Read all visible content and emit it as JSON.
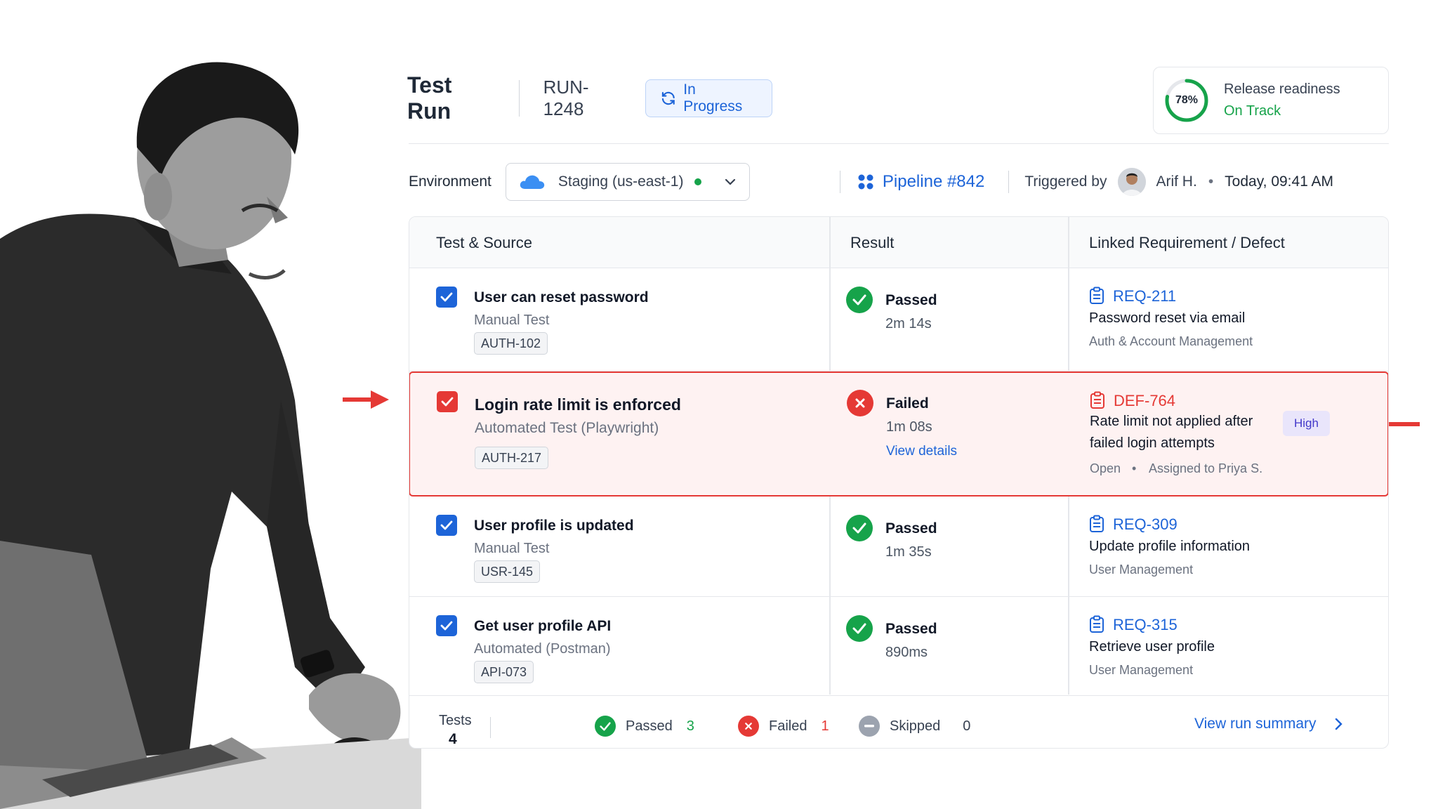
{
  "header": {
    "title": "Test Run",
    "run_id": "RUN-1248",
    "status": "In Progress"
  },
  "readiness": {
    "percent_label": "78%",
    "percent_value": 0.78,
    "label": "Release readiness",
    "status": "On Track"
  },
  "environment": {
    "label": "Environment",
    "selected": "Staging (us-east-1)",
    "health": "green"
  },
  "pipeline": {
    "label": "Pipeline #842"
  },
  "trigger": {
    "label": "Triggered by",
    "user": "Arif H.",
    "time": "Today, 09:41 AM"
  },
  "table": {
    "columns": [
      "Test & Source",
      "Result",
      "Linked Requirement / Defect"
    ],
    "rows": [
      {
        "name": "User can reset password",
        "type": "Manual Test",
        "test_id": "AUTH-102",
        "result": "Passed",
        "duration": "2m 14s",
        "link_id": "REQ-211",
        "link_title": "Password reset via email",
        "link_sub": "Auth & Account Management"
      },
      {
        "name": "Login rate limit is enforced",
        "type": "Automated Test (Playwright)",
        "test_id": "AUTH-217",
        "result": "Failed",
        "duration": "1m 08s",
        "details_link": "View details",
        "link_id": "DEF-764",
        "link_title_1": "Rate limit not applied after",
        "link_title_2": "failed login attempts",
        "link_status": "Open",
        "link_assignee": "Assigned to Priya S.",
        "severity": "High"
      },
      {
        "name": "User profile is updated",
        "type": "Manual Test",
        "test_id": "USR-145",
        "result": "Passed",
        "duration": "1m 35s",
        "link_id": "REQ-309",
        "link_title": "Update profile information",
        "link_sub": "User Management"
      },
      {
        "name": "Get user profile API",
        "type": "Automated (Postman)",
        "test_id": "API-073",
        "result": "Passed",
        "duration": "890ms",
        "link_id": "REQ-315",
        "link_title": "Retrieve user profile",
        "link_sub": "User Management"
      }
    ]
  },
  "footer": {
    "tests_label": "Tests",
    "tests_count": "4",
    "passed_label": "Passed",
    "passed_count": "3",
    "failed_label": "Failed",
    "failed_count": "1",
    "skipped_label": "Skipped",
    "skipped_count": "0",
    "summary_link": "View run summary"
  },
  "colors": {
    "accent": "#1d64d8",
    "passed": "#16a34a",
    "failed": "#e53935",
    "skipped": "#9ca3af",
    "failed_row_bg": "#fef2f2"
  },
  "icons": {
    "status": "refresh-icon",
    "environment": "cloud-icon",
    "pipeline": "pipeline-icon",
    "requirement": "clipboard-icon",
    "pass": "check-circle-icon",
    "fail": "x-circle-icon",
    "skip": "minus-circle-icon"
  }
}
